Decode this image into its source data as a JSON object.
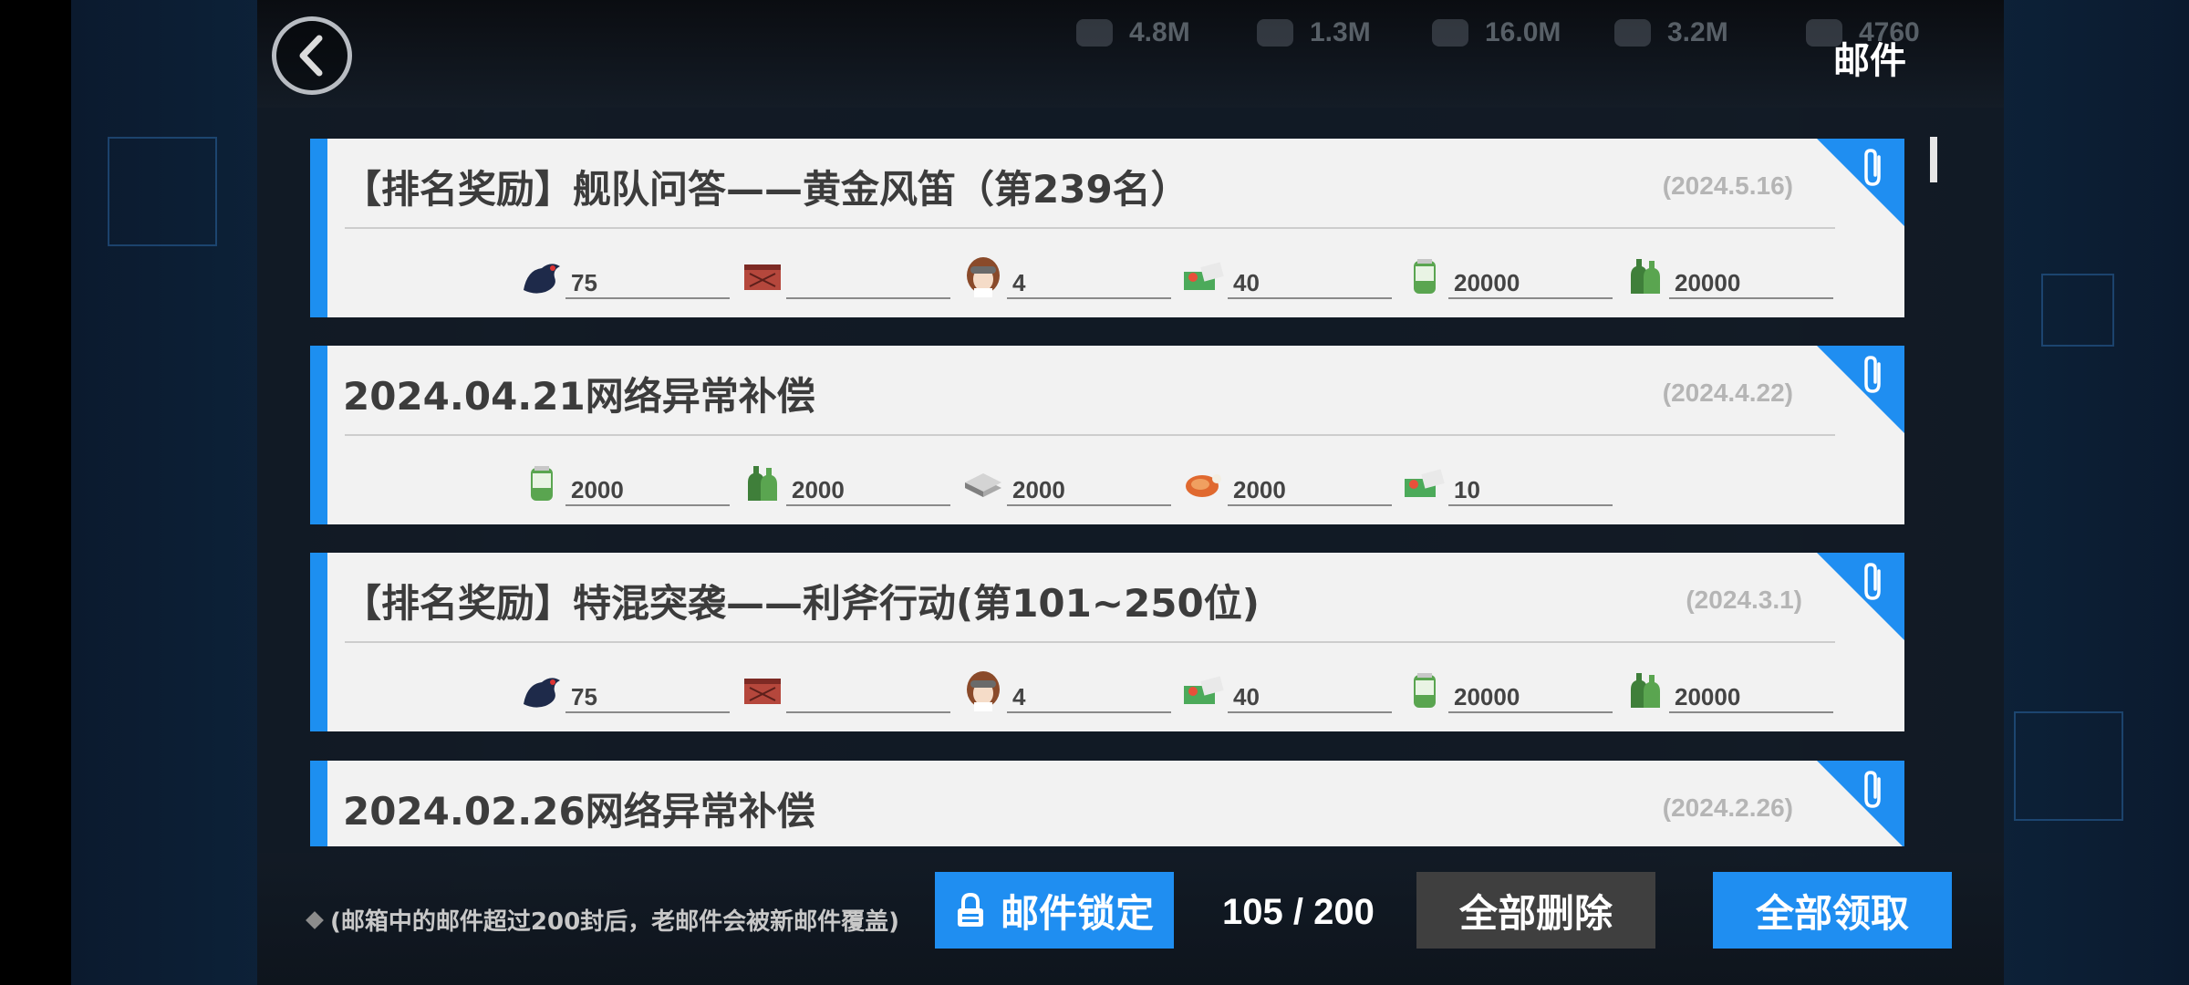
{
  "header": {
    "title": "邮件",
    "resources": [
      {
        "icon": "ammo-icon",
        "value": "4.8M"
      },
      {
        "icon": "ration-icon",
        "value": "1.3M"
      },
      {
        "icon": "parts-icon",
        "value": "16.0M"
      },
      {
        "icon": "food-icon",
        "value": "3.2M"
      },
      {
        "icon": "gem-icon",
        "value": "4760"
      }
    ]
  },
  "mails": [
    {
      "title": "【排名奖励】舰队问答——黄金风笛（第239名）",
      "date": "(2024.5.16)",
      "items": [
        {
          "icon": "bird-icon",
          "qty": "75"
        },
        {
          "icon": "crate-icon",
          "qty": ""
        },
        {
          "icon": "pilot-icon",
          "qty": "4"
        },
        {
          "icon": "supply-box-icon",
          "qty": "40"
        },
        {
          "icon": "fuel-can-icon",
          "qty": "20000"
        },
        {
          "icon": "bottles-icon",
          "qty": "20000"
        }
      ]
    },
    {
      "title": "2024.04.21网络异常补偿",
      "date": "(2024.4.22)",
      "items": [
        {
          "icon": "fuel-can-icon",
          "qty": "2000"
        },
        {
          "icon": "bottles-icon",
          "qty": "2000"
        },
        {
          "icon": "steel-icon",
          "qty": "2000"
        },
        {
          "icon": "meat-icon",
          "qty": "2000"
        },
        {
          "icon": "supply-box-icon",
          "qty": "10"
        }
      ]
    },
    {
      "title": "【排名奖励】特混突袭——利斧行动(第101~250位)",
      "date": "(2024.3.1)",
      "items": [
        {
          "icon": "bird-icon",
          "qty": "75"
        },
        {
          "icon": "crate-icon",
          "qty": ""
        },
        {
          "icon": "pilot-icon",
          "qty": "4"
        },
        {
          "icon": "supply-box-icon",
          "qty": "40"
        },
        {
          "icon": "fuel-can-icon",
          "qty": "20000"
        },
        {
          "icon": "bottles-icon",
          "qty": "20000"
        }
      ]
    },
    {
      "title": "2024.02.26网络异常补偿",
      "date": "(2024.2.26)",
      "items": []
    }
  ],
  "footer": {
    "note": "(邮箱中的邮件超过200封后，老邮件会被新邮件覆盖)",
    "lock_label": "邮件锁定",
    "count": "105 / 200",
    "delete_all_label": "全部删除",
    "claim_all_label": "全部领取"
  },
  "colors": {
    "accent": "#1f8ef1",
    "card_bg": "#f2f2f2",
    "delete_bg": "#3f3f3f"
  }
}
